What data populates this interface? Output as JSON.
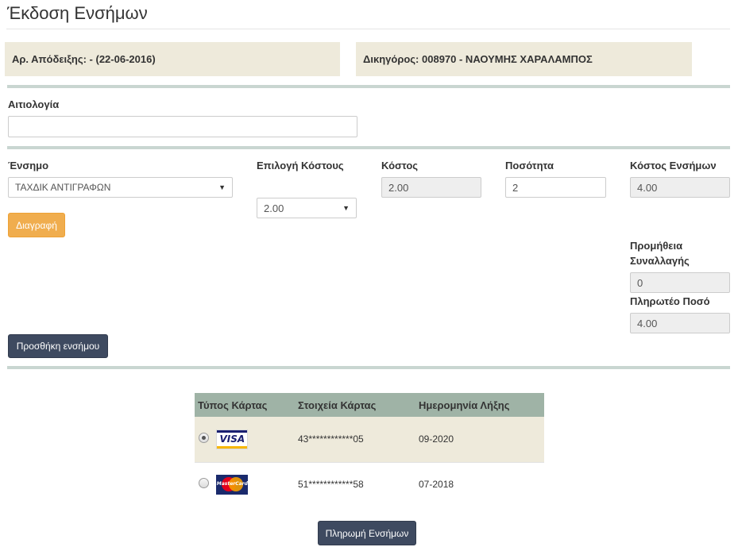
{
  "page": {
    "title": "Έκδοση Ενσήμων"
  },
  "info": {
    "receipt": "Αρ. Απόδειξης: -   (22-06-2016)",
    "lawyer": "Δικηγόρος: 008970 - ΝΑΟΥΜΗΣ ΧΑΡΑΛΑΜΠΟΣ"
  },
  "reason": {
    "label": "Αιτιολογία",
    "value": ""
  },
  "stamp_row": {
    "stamp_label": "Ένσημο",
    "stamp_value": "ΤΑΧΔΙΚ ΑΝΤΙΓΡΑΦΩΝ",
    "cost_choice_label": "Επιλογή Κόστους",
    "cost_choice_value": "2.00",
    "cost_label": "Κόστος",
    "cost_value": "2.00",
    "quantity_label": "Ποσότητα",
    "quantity_value": "2",
    "stamps_cost_label": "Κόστος Ενσήμων",
    "stamps_cost_value": "4.00"
  },
  "buttons": {
    "delete": "Διαγραφή",
    "add_stamp": "Προσθήκη ενσήμου",
    "pay": "Πληρωμή Ενσήμων"
  },
  "summary": {
    "commission_label_line1": "Προμήθεια",
    "commission_label_line2": "Συναλλαγής",
    "commission_value": "0",
    "payable_label": "Πληρωτέο Ποσό",
    "payable_value": "4.00"
  },
  "cards": {
    "headers": [
      "Τύπος Κάρτας",
      "Στοιχεία Κάρτας",
      "Ημερομηνία Λήξης"
    ],
    "rows": [
      {
        "type": "VISA",
        "logo_text": "VISA",
        "number": "43************05",
        "expiry": "09-2020",
        "selected": true
      },
      {
        "type": "MasterCard",
        "logo_text": "MasterCard",
        "number": "51************58",
        "expiry": "07-2018",
        "selected": false
      }
    ]
  },
  "colors": {
    "info_bg": "#eeeadb",
    "separator": "#c9d6d1",
    "table_header": "#9fb3a6",
    "warning": "#f0ad4e",
    "dark_button": "#3e4a60"
  }
}
